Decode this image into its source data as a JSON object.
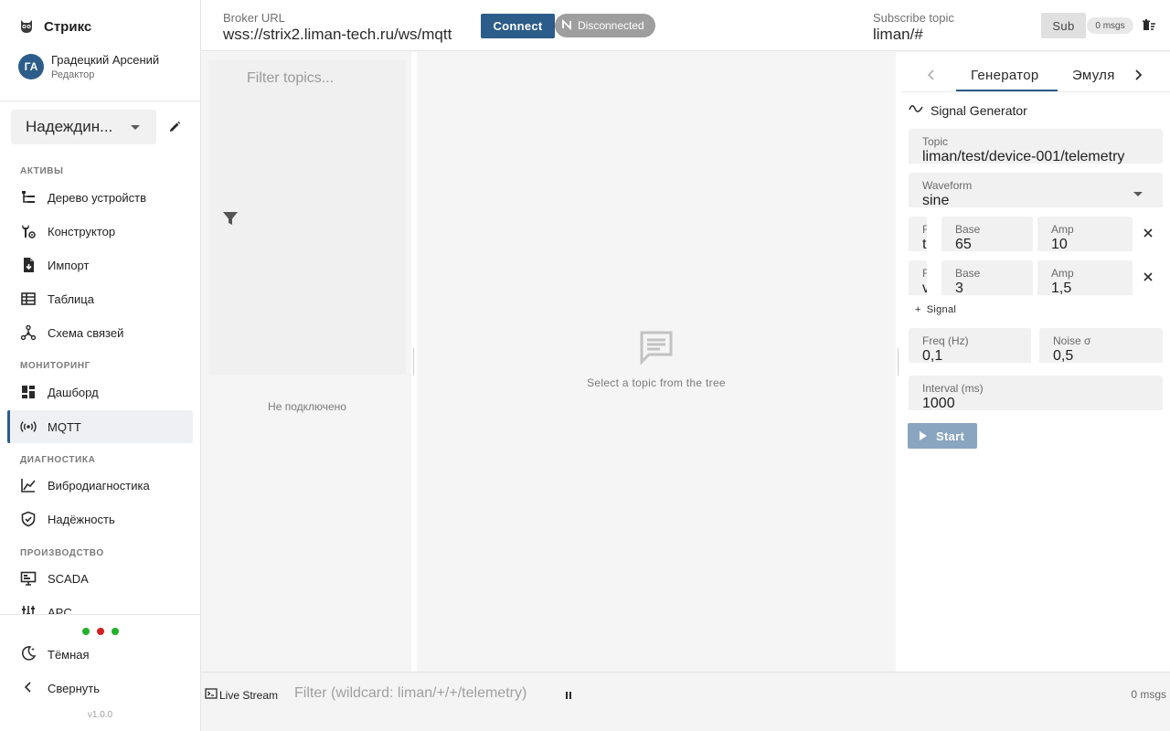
{
  "app": {
    "brand": "Стрикс",
    "version": "v1.0.0"
  },
  "user": {
    "initials": "ГА",
    "name": "Градецкий Арсений",
    "role": "Редактор"
  },
  "project": {
    "selected": "Надеждин..."
  },
  "nav": {
    "sections": {
      "assets": "АКТИВЫ",
      "monitoring": "МОНИТОРИНГ",
      "diagnostics": "ДИАГНОСТИКА",
      "production": "ПРОИЗВОДСТВО"
    },
    "items": {
      "device_tree": "Дерево устройств",
      "constructor": "Конструктор",
      "import": "Импорт",
      "table": "Таблица",
      "links": "Схема связей",
      "dashboard": "Дашборд",
      "mqtt": "MQTT",
      "vibro": "Вибродиагностика",
      "reliability": "Надёжность",
      "scada": "SCADA",
      "apc": "APC"
    },
    "bottom": {
      "theme": "Тёмная",
      "collapse": "Свернуть"
    },
    "status_dots": [
      "#22b02a",
      "#d42020",
      "#22b02a"
    ]
  },
  "topbar": {
    "broker_label": "Broker URL",
    "broker_url": "wss://strix2.liman-tech.ru/ws/mqtt",
    "connect": "Connect",
    "status": "Disconnected",
    "subscribe_label": "Subscribe topic",
    "subscribe_topic": "liman/#",
    "sub": "Sub",
    "msgs": "0 msgs"
  },
  "topics": {
    "filter_placeholder": "Filter topics...",
    "not_connected": "Не подключено"
  },
  "viewer": {
    "empty": "Select a topic from the tree"
  },
  "generator": {
    "tabs": [
      "Генератор",
      "Эмуля"
    ],
    "title": "Signal Generator",
    "topic_label": "Topic",
    "topic": "liman/test/device-001/telemetry",
    "waveform_label": "Waveform",
    "waveform": "sine",
    "signals": [
      {
        "field_label": "F",
        "field_value": "t",
        "base_label": "Base",
        "base": "65",
        "amp_label": "Amp",
        "amp": "10"
      },
      {
        "field_label": "F",
        "field_value": "v",
        "base_label": "Base",
        "base": "3",
        "amp_label": "Amp",
        "amp": "1,5"
      }
    ],
    "add_signal": "Signal",
    "freq_label": "Freq (Hz)",
    "freq": "0,1",
    "noise_label": "Noise σ",
    "noise": "0,5",
    "interval_label": "Interval (ms)",
    "interval": "1000",
    "start": "Start"
  },
  "stream": {
    "label": "Live Stream",
    "filter_placeholder": "Filter (wildcard: liman/+/+/telemetry)",
    "count": "0 msgs"
  },
  "colors": {
    "accent": "#2b5c8a",
    "start_disabled": "#8aa5c0",
    "status_chip": "#9e9e9e"
  }
}
